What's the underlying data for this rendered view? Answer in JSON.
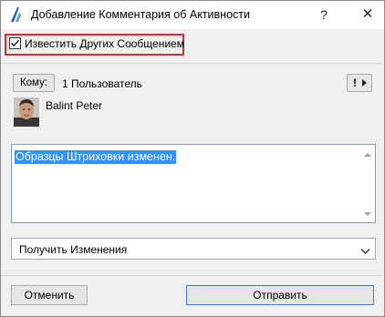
{
  "window": {
    "title": "Добавление Комментария об Активности",
    "help_label": "?",
    "close_label": "✕"
  },
  "notify": {
    "label": "Известить Других Сообщением",
    "checked": true
  },
  "recipients": {
    "to_button_label": "Кому:",
    "count_text": "1 Пользователь",
    "more_button_label": "!",
    "user_name": "Balint Peter"
  },
  "comment": {
    "text": "Образцы Штриховки изменен."
  },
  "action_select": {
    "selected": "Получить Изменения"
  },
  "footer": {
    "cancel_label": "Отменить",
    "send_label": "Отправить"
  },
  "icons": {
    "app": "archicad-logo-icon",
    "more_arrow": "triangle-right-icon",
    "dropdown": "chevron-down-icon"
  },
  "colors": {
    "highlight_border": "#e0262e",
    "selection": "#3390ff",
    "default_button_border": "#3d7bd5"
  }
}
